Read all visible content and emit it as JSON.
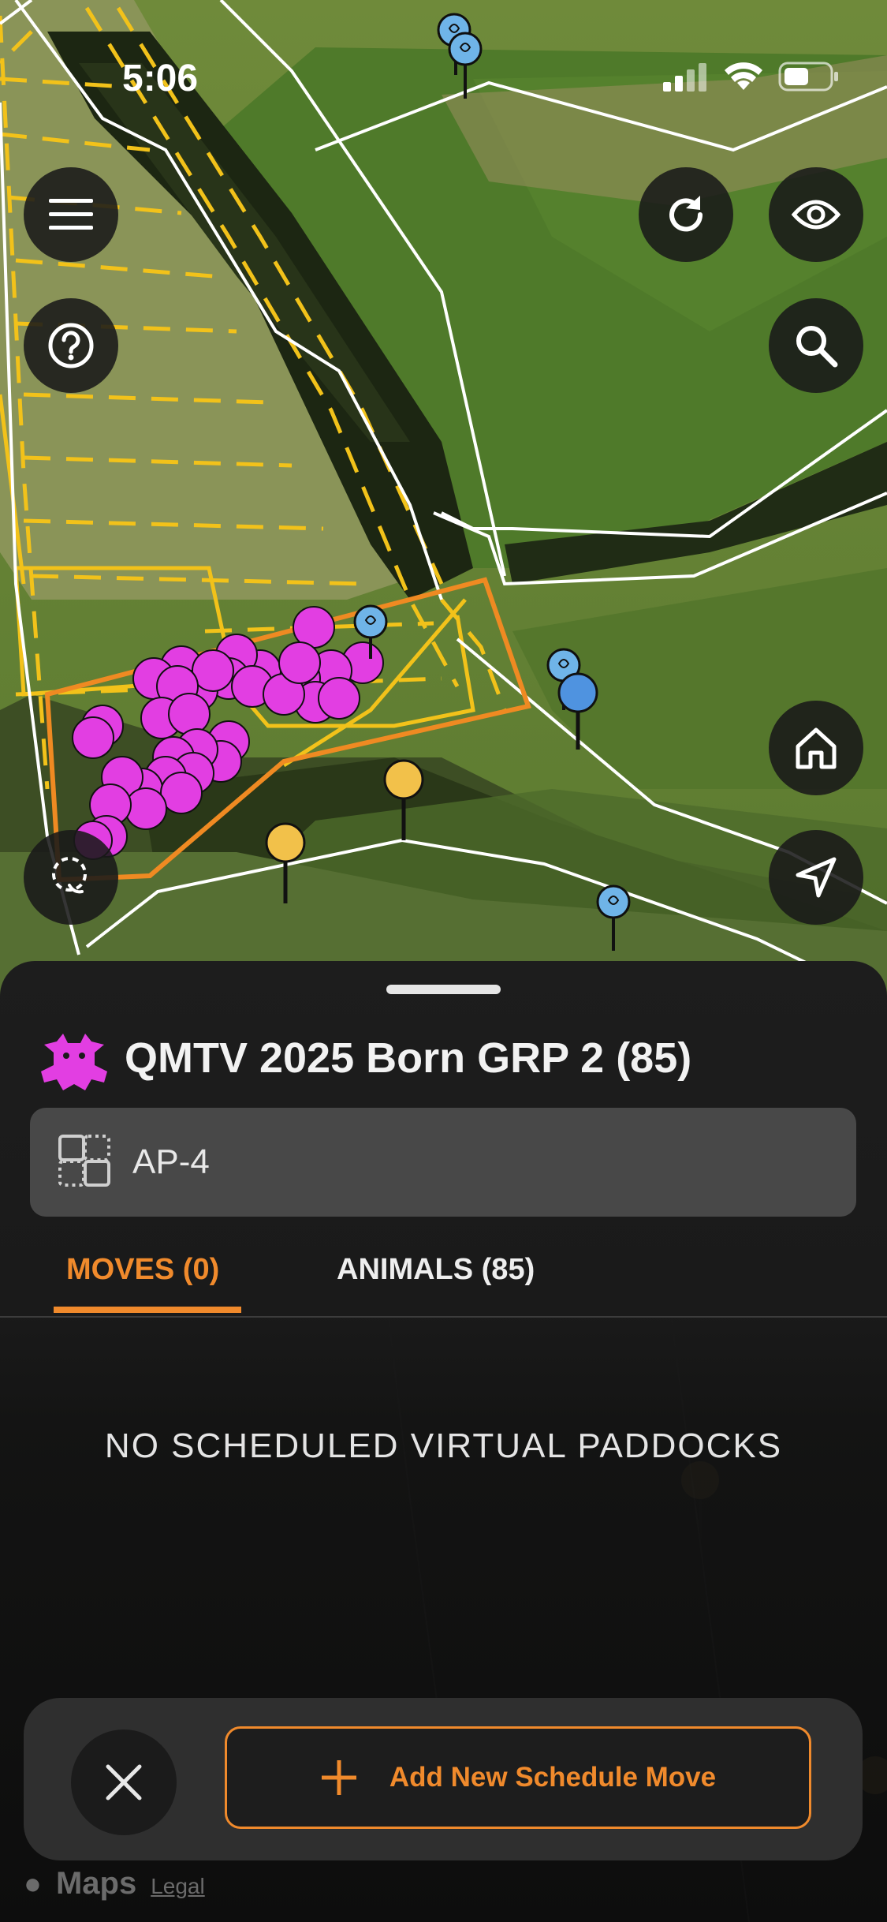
{
  "status_bar": {
    "time": "5:06"
  },
  "map": {
    "herd_marker_color": "#e23ee2",
    "boundary_color": "#ffffff",
    "paddock_color": "#f2c21a",
    "active_paddock_color": "#ef8a22",
    "tag_pin_color": "#6fb4e8",
    "yellow_pin_color": "#f2c14a"
  },
  "controls": {
    "menu": "menu-icon",
    "help": "help-icon",
    "refresh": "refresh-icon",
    "visibility": "eye-icon",
    "search": "search-icon",
    "home": "home-icon",
    "locate": "location-arrow-icon",
    "lasso": "lasso-icon"
  },
  "sheet": {
    "herd_name": "QMTV 2025 Born GRP 2 (85)",
    "paddock": "AP-4",
    "tabs": [
      {
        "label": "MOVES (0)",
        "active": true
      },
      {
        "label": "ANIMALS (85)",
        "active": false
      }
    ],
    "empty_message": "NO SCHEDULED VIRTUAL PADDOCKS",
    "close_label": "close-icon",
    "add_label": "Add New Schedule Move",
    "accent_color": "#f08a2c"
  },
  "attribution": {
    "maps": "Maps",
    "legal": "Legal"
  }
}
